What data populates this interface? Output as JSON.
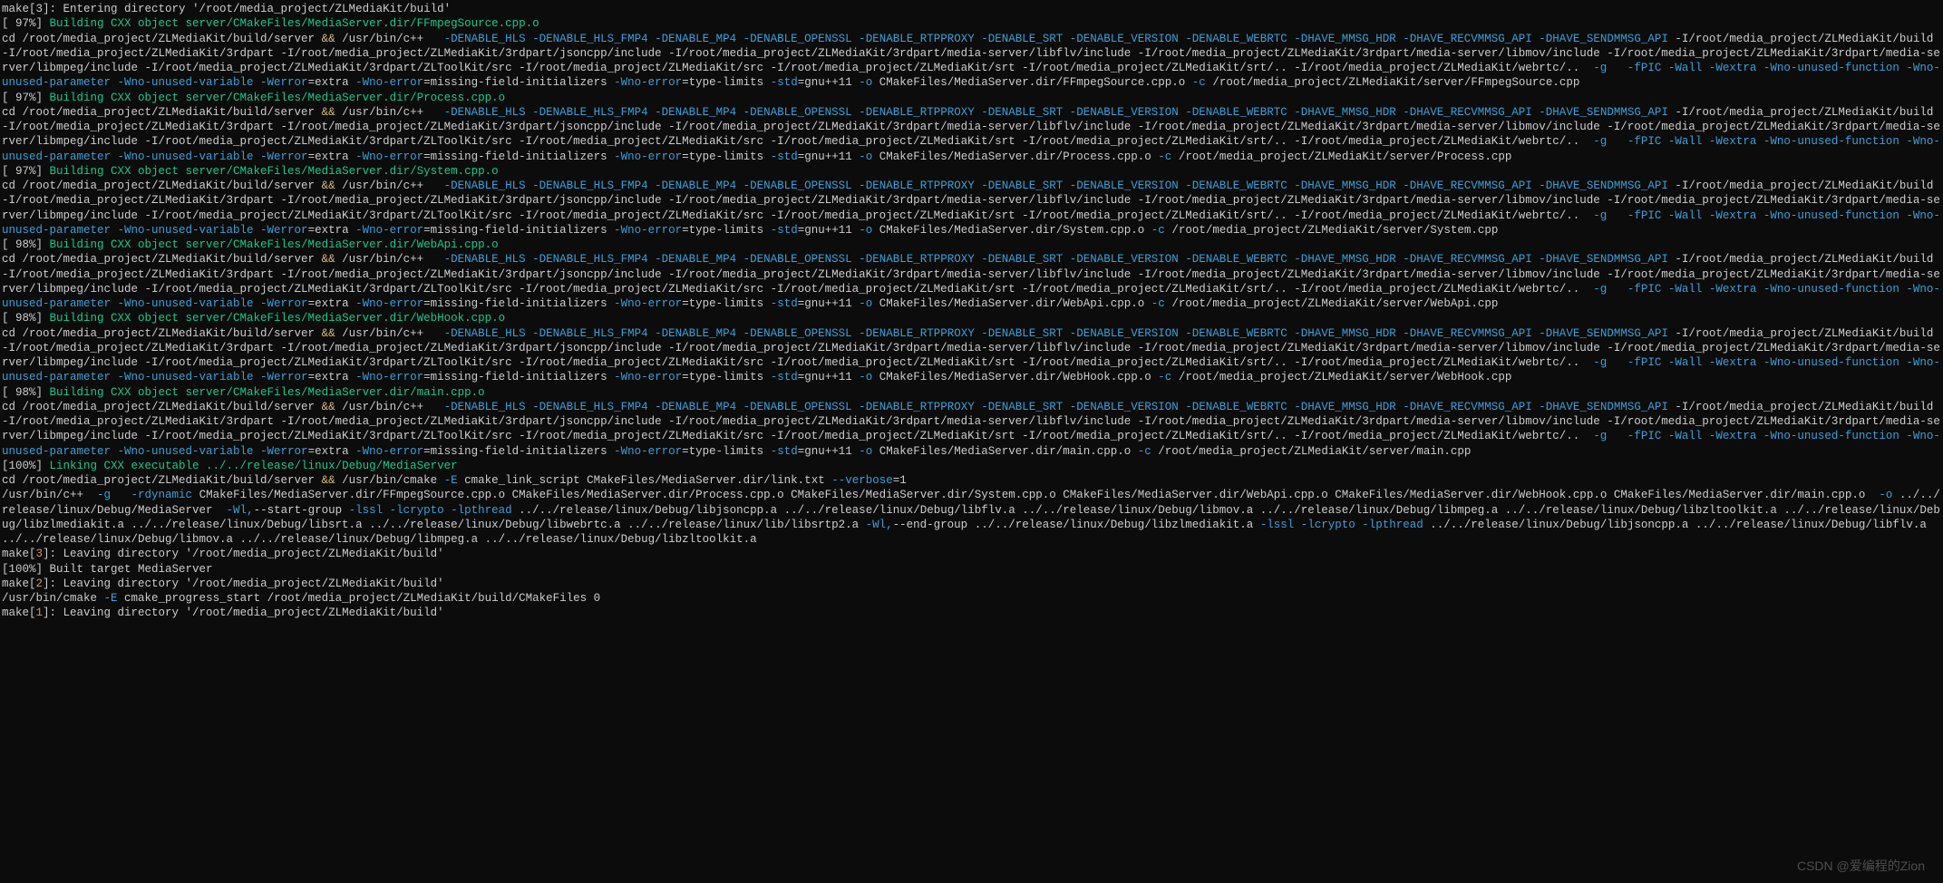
{
  "watermark": "CSDN @爱编程的Zion",
  "build": {
    "dir_enter": "make[3]: Entering directory '/root/media_project/ZLMediaKit/build'",
    "steps": [
      {
        "pct": "97%",
        "obj": "Building CXX object server/CMakeFiles/MediaServer.dir/FFmpegSource.cpp.o",
        "out": "CMakeFiles/MediaServer.dir/FFmpegSource.cpp.o",
        "src": "/root/media_project/ZLMediaKit/server/FFmpegSource.cpp"
      },
      {
        "pct": "97%",
        "obj": "Building CXX object server/CMakeFiles/MediaServer.dir/Process.cpp.o",
        "out": "CMakeFiles/MediaServer.dir/Process.cpp.o",
        "src": "/root/media_project/ZLMediaKit/server/Process.cpp"
      },
      {
        "pct": "97%",
        "obj": "Building CXX object server/CMakeFiles/MediaServer.dir/System.cpp.o",
        "out": "CMakeFiles/MediaServer.dir/System.cpp.o",
        "src": "/root/media_project/ZLMediaKit/server/System.cpp"
      },
      {
        "pct": "98%",
        "obj": "Building CXX object server/CMakeFiles/MediaServer.dir/WebApi.cpp.o",
        "out": "CMakeFiles/MediaServer.dir/WebApi.cpp.o",
        "src": "/root/media_project/ZLMediaKit/server/WebApi.cpp"
      },
      {
        "pct": "98%",
        "obj": "Building CXX object server/CMakeFiles/MediaServer.dir/WebHook.cpp.o",
        "out": "CMakeFiles/MediaServer.dir/WebHook.cpp.o",
        "src": "/root/media_project/ZLMediaKit/server/WebHook.cpp"
      },
      {
        "pct": "98%",
        "obj": "Building CXX object server/CMakeFiles/MediaServer.dir/main.cpp.o",
        "out": "CMakeFiles/MediaServer.dir/main.cpp.o",
        "src": "/root/media_project/ZLMediaKit/server/main.cpp"
      }
    ],
    "cd_prefix": "cd /root/media_project/ZLMediaKit/build/server ",
    "andand": "&&",
    "cxx": " /usr/bin/c++ ",
    "defines": "  -DENABLE_HLS -DENABLE_HLS_FMP4 -DENABLE_MP4 -DENABLE_OPENSSL -DENABLE_RTPPROXY -DENABLE_SRT -DENABLE_VERSION -DENABLE_WEBRTC -DHAVE_MMSG_HDR -DHAVE_RECVMMSG_API -DHAVE_SENDMMSG_API",
    "includes": " -I/root/media_project/ZLMediaKit/build -I/root/media_project/ZLMediaKit/3rdpart -I/root/media_project/ZLMediaKit/3rdpart/jsoncpp/include -I/root/media_project/ZLMediaKit/3rdpart/media-server/libflv/include -I/root/media_project/ZLMediaKit/3rdpart/media-server/libmov/include -I/root/media_project/ZLMediaKit/3rdpart/media-server/libmpeg/include -I/root/media_project/ZLMediaKit/3rdpart/ZLToolKit/src -I/root/media_project/ZLMediaKit/src -I/root/media_project/ZLMediaKit/srt -I/root/media_project/ZLMediaKit/srt/.. -I/root/media_project/ZLMediaKit/webrtc/.. ",
    "gflag": " -g ",
    "warns": "  -fPIC -Wall -Wextra -Wno-unused-function -Wno-unused-parameter -Wno-unused-variable -Werror",
    "eq_ex": "=extra ",
    "wnoerr": "-Wno-error",
    "eq_mfi": "=missing-field-initializers ",
    "eq_tl": "=type-limits ",
    "std": "-std",
    "eq_gnu": "=gnu++11 ",
    "dash_o": "-o",
    "dash_c": " -c",
    "link_pct": "100%",
    "link_msg": "Linking CXX executable ../../release/linux/Debug/MediaServer",
    "link_cd": "cd /root/media_project/ZLMediaKit/build/server ",
    "link_cmake": " /usr/bin/cmake ",
    "link_E": "-E",
    "link_script": " cmake_link_script CMakeFiles/MediaServer.dir/link.txt ",
    "verbose": "--verbose",
    "eq1": "=1",
    "link2_pre": "/usr/bin/c++  ",
    "link2_g": "-g",
    "link2_rdyn": "   -rdynamic",
    "link2_objs": " CMakeFiles/MediaServer.dir/FFmpegSource.cpp.o CMakeFiles/MediaServer.dir/Process.cpp.o CMakeFiles/MediaServer.dir/System.cpp.o CMakeFiles/MediaServer.dir/WebApi.cpp.o CMakeFiles/MediaServer.dir/WebHook.cpp.o CMakeFiles/MediaServer.dir/main.cpp.o  ",
    "link2_o": "-o",
    "link2_out": " ../../release/linux/Debug/MediaServer  ",
    "link2_wl1": "-Wl,",
    "link2_sg": "--start-group ",
    "link2_libs1": "-lssl -lcrypto -lpthread",
    "link2_rel1": " ../../release/linux/Debug/libjsoncpp.a ../../release/linux/Debug/libflv.a ../../release/linux/Debug/libmov.a ../../release/linux/Debug/libmpeg.a ../../release/linux/Debug/libzltoolkit.a ../../release/linux/Debug/libzlmediakit.a ../../release/linux/Debug/libsrt.a ../../release/linux/Debug/libwebrtc.a ../../release/linux/lib/libsrtp2.a ",
    "link2_wl2": "-Wl,",
    "link2_eg": "--end-group",
    "link2_rel2": " ../../release/linux/Debug/libzlmediakit.a ",
    "link2_libs2": "-lssl -lcrypto -lpthread",
    "link2_rel3": " ../../release/linux/Debug/libjsoncpp.a ../../release/linux/Debug/libflv.a ../../release/linux/Debug/libmov.a ../../release/linux/Debug/libmpeg.a ../../release/linux/Debug/libzltoolkit.a",
    "leave3": "make[3]: Leaving directory '/root/media_project/ZLMediaKit/build'",
    "built_pct": "100%",
    "built_msg": "] Built target MediaServer",
    "leave2": "make[2]: Leaving directory '/root/media_project/ZLMediaKit/build'",
    "progress": "/usr/bin/cmake ",
    "progress_E": "-E",
    "progress_rest": " cmake_progress_start /root/media_project/ZLMediaKit/build/CMakeFiles 0",
    "leave1": "make[1]: Leaving directory '/root/media_project/ZLMediaKit/build'"
  }
}
